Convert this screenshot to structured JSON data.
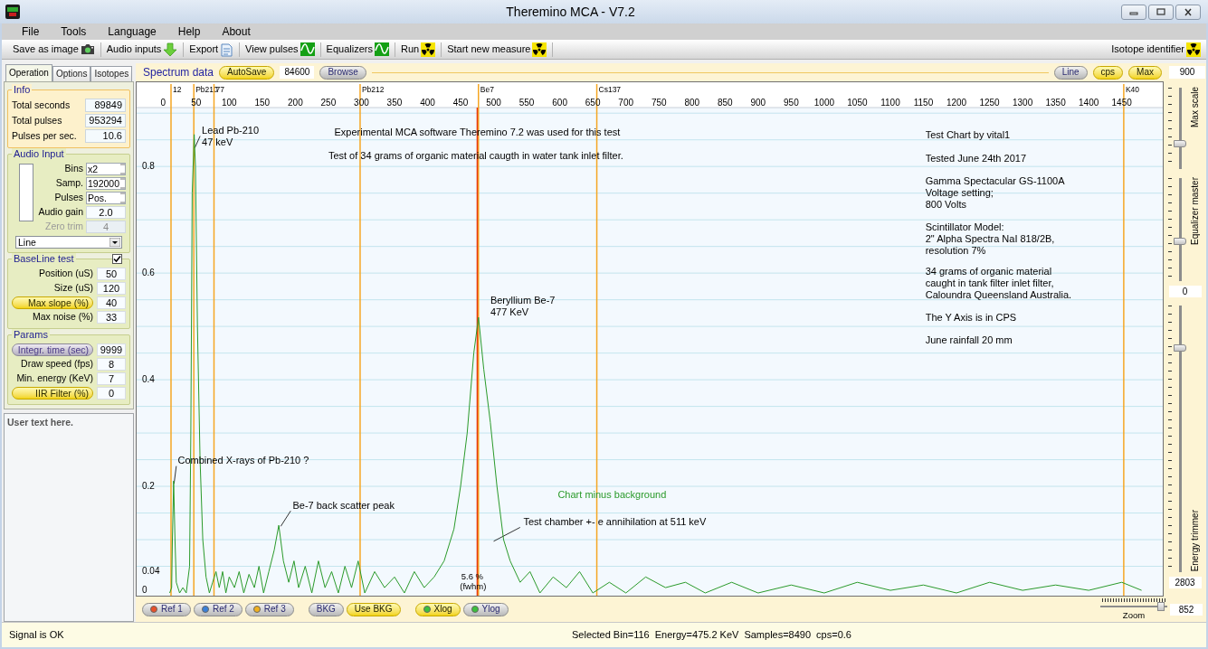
{
  "window": {
    "title": "Theremino MCA - V7.2"
  },
  "menu": [
    "File",
    "Tools",
    "Language",
    "Help",
    "About"
  ],
  "toolbar": [
    {
      "label": "Save as image"
    },
    {
      "label": "Audio inputs"
    },
    {
      "label": "Export"
    },
    {
      "label": "View pulses"
    },
    {
      "label": "Equalizers"
    },
    {
      "label": "Run"
    },
    {
      "label": "Start new measure"
    }
  ],
  "toolbar_right": {
    "label": "Isotope identifier"
  },
  "left_panel": {
    "tabs": [
      {
        "label": "Operation",
        "selected": true
      },
      {
        "label": "Options",
        "selected": false
      },
      {
        "label": "Isotopes",
        "selected": false
      }
    ],
    "info": {
      "title": "Info",
      "rows": [
        {
          "label": "Total seconds",
          "value": "89849"
        },
        {
          "label": "Total pulses",
          "value": "953294"
        },
        {
          "label": "Pulses per sec.",
          "value": "10.6"
        }
      ]
    },
    "audio_input": {
      "title": "Audio Input",
      "rows": [
        {
          "label": "Bins",
          "value": "x2",
          "kind": "spinner",
          "disabled": false
        },
        {
          "label": "Samp.",
          "value": "192000",
          "kind": "spinner",
          "disabled": false
        },
        {
          "label": "Pulses",
          "value": "Pos.",
          "kind": "spinner",
          "disabled": false
        },
        {
          "label": "Audio gain",
          "value": "2.0",
          "kind": "field",
          "disabled": false
        },
        {
          "label": "Zero trim",
          "value": "4",
          "kind": "field",
          "disabled": true
        }
      ],
      "dropdown": "Line"
    },
    "baseline_test": {
      "title": "BaseLine test",
      "checked": true,
      "rows": [
        {
          "label": "Position (uS)",
          "value": "50",
          "kind": "field"
        },
        {
          "label": "Size (uS)",
          "value": "120",
          "kind": "field"
        },
        {
          "label": "Max slope (%)",
          "value": "40",
          "kind": "toggle",
          "on": true
        },
        {
          "label": "Max noise (%)",
          "value": "33",
          "kind": "field"
        }
      ]
    },
    "params": {
      "title": "Params",
      "rows": [
        {
          "label": "Integr. time (sec)",
          "value": "9999",
          "kind": "toggle",
          "on": false
        },
        {
          "label": "Draw speed (fps)",
          "value": "8",
          "kind": "field"
        },
        {
          "label": "Min. energy (KeV)",
          "value": "7",
          "kind": "field"
        },
        {
          "label": "IIR Filter (%)",
          "value": "0",
          "kind": "toggle",
          "on": true
        }
      ]
    },
    "user_text": "User text here."
  },
  "spectrum_bar": {
    "title": "Spectrum data",
    "autosave": {
      "label": "AutoSave",
      "on": true
    },
    "period": "84600",
    "browse": "Browse",
    "buttons": [
      {
        "label": "Line",
        "on": false
      },
      {
        "label": "cps",
        "on": true
      },
      {
        "label": "Max",
        "on": true
      }
    ],
    "max_value": "900"
  },
  "chart": {
    "chart_data": {
      "type": "line",
      "grid": true,
      "ylim": [
        0,
        0.958
      ],
      "xlim": [
        -40,
        1512
      ],
      "xticks": [
        0,
        50,
        100,
        150,
        200,
        250,
        300,
        350,
        400,
        450,
        500,
        550,
        600,
        650,
        700,
        750,
        800,
        850,
        900,
        950,
        1000,
        1050,
        1100,
        1150,
        1200,
        1250,
        1300,
        1350,
        1400,
        1450
      ],
      "yticks": [
        0.8,
        0.6,
        0.4,
        0.2,
        0.04,
        0
      ],
      "x": [
        10,
        13,
        14,
        16,
        18,
        20,
        25,
        30,
        35,
        40,
        42,
        44,
        47,
        49,
        52,
        56,
        60,
        65,
        70,
        75,
        80,
        85,
        90,
        95,
        100,
        108,
        115,
        122,
        130,
        138,
        145,
        152,
        160,
        168,
        175,
        182,
        190,
        198,
        205,
        215,
        225,
        235,
        245,
        255,
        265,
        275,
        285,
        295,
        305,
        320,
        335,
        350,
        365,
        380,
        395,
        410,
        425,
        440,
        450,
        460,
        470,
        477,
        485,
        495,
        505,
        515,
        525,
        540,
        555,
        570,
        590,
        610,
        630,
        650,
        675,
        700,
        730,
        760,
        790,
        820,
        860,
        900,
        950,
        1000,
        1050,
        1100,
        1150,
        1200,
        1250,
        1300,
        1350,
        1400,
        1450,
        1480
      ],
      "series": [
        {
          "name": "Chart minus background",
          "color": "#2a9a2a",
          "values": [
            0,
            0.01,
            0.1,
            0.21,
            0.1,
            0.02,
            0,
            0.01,
            0,
            0.05,
            0.3,
            0.75,
            0.86,
            0.8,
            0.5,
            0.25,
            0.1,
            0.03,
            0,
            0.02,
            0.04,
            0.01,
            0.04,
            0,
            0.03,
            0.01,
            0.04,
            0,
            0.035,
            0.01,
            0.05,
            0,
            0.04,
            0.08,
            0.127,
            0.06,
            0.02,
            0.06,
            0.01,
            0.05,
            0,
            0.06,
            0.01,
            0.04,
            0,
            0.05,
            0.01,
            0.06,
            0,
            0.04,
            0.01,
            0.03,
            0,
            0.04,
            0.01,
            0.03,
            0.06,
            0.12,
            0.2,
            0.3,
            0.45,
            0.517,
            0.42,
            0.32,
            0.2,
            0.1,
            0.06,
            0.02,
            0.04,
            0,
            0.03,
            0.01,
            0.04,
            0,
            0.02,
            0,
            0.03,
            0.01,
            0.02,
            0,
            0.02,
            0,
            0.015,
            0,
            0.02,
            0.005,
            0.015,
            0,
            0.02,
            0.005,
            0.015,
            0.005,
            0.02,
            0.005
          ]
        }
      ],
      "ref_lines": [
        {
          "axis": "x",
          "value": 12,
          "label": "12",
          "color": "#f5a623"
        },
        {
          "axis": "x",
          "value": 46.5,
          "label": "Pb210",
          "color": "#f5a623"
        },
        {
          "axis": "x",
          "value": 77,
          "label": "77",
          "color": "#f5a623"
        },
        {
          "axis": "x",
          "value": 298,
          "label": "Pb212",
          "color": "#f5a623"
        },
        {
          "axis": "x",
          "value": 477,
          "label": "Be7",
          "color": "#f5a623"
        },
        {
          "axis": "x",
          "value": 656,
          "label": "Cs137",
          "color": "#f5a623"
        },
        {
          "axis": "x",
          "value": 1453,
          "label": "K40",
          "color": "#f5a623"
        },
        {
          "axis": "x",
          "value": 475.2,
          "color": "#e83a10"
        }
      ],
      "annotations": [
        "Lead Pb-210",
        "47 keV",
        "Experimental MCA software Theremino 7.2 was used for this test",
        "Test of 34 grams of organic material caugth in water tank inlet filter.",
        "Test Chart by vital1",
        "Tested June 24th 2017",
        "Gamma Spectacular GS-1100A",
        "Voltage setting;",
        "800 Volts",
        "Scintillator Model:",
        "2\" Alpha Spectra NaI 818/2B,",
        "resolution 7%",
        "34 grams of organic material",
        "caught in tank filter inlet filter,",
        "Caloundra Queensland Australia.",
        "The Y Axis is in CPS",
        "June rainfall 20 mm",
        "Beryllium Be-7",
        "477 KeV",
        "Combined X-rays of Pb-210 ?",
        "Be-7 back scatter peak",
        "Test chamber +- e annihilation at 511 keV",
        "5.6 %",
        "(fwhm)"
      ]
    }
  },
  "side_panel": {
    "sliders": [
      {
        "label": "Max scale",
        "level": 0.31
      },
      {
        "label": "Equalizer master",
        "level": 0.39,
        "value": "0"
      },
      {
        "label": "Energy trimmer",
        "level": 0.84,
        "value": "2803"
      }
    ]
  },
  "bottom_bar": {
    "buttons": [
      {
        "label": "Ref 1",
        "kind": "ref",
        "on": false,
        "color": "#e8502a"
      },
      {
        "label": "Ref 2",
        "kind": "ref",
        "on": false,
        "color": "#3a80d8"
      },
      {
        "label": "Ref 3",
        "kind": "ref",
        "on": false,
        "color": "#f0b020"
      },
      {
        "label": "BKG",
        "kind": "bkg",
        "on": false
      },
      {
        "label": "Use BKG",
        "kind": "bkg",
        "on": true
      },
      {
        "label": "Xlog",
        "kind": "scale",
        "on": true,
        "color": "#3cc03c"
      },
      {
        "label": "Ylog",
        "kind": "scale",
        "on": false,
        "color": "#3cc03c"
      }
    ],
    "zoom": {
      "label": "Zoom",
      "level": 0.9,
      "value": "852"
    }
  },
  "status_bar": {
    "left": "Signal is OK",
    "items": [
      "Selected Bin=116",
      "Energy=475.2 KeV",
      "Samples=8490",
      "cps=0.6"
    ]
  }
}
